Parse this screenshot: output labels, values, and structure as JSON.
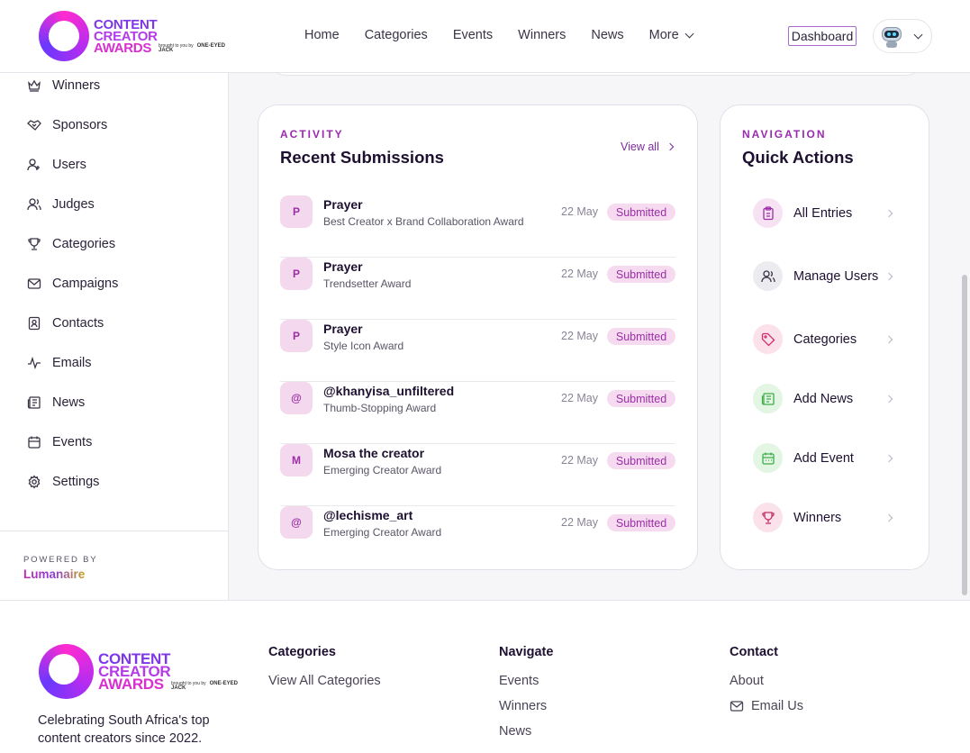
{
  "brand": {
    "name_lines": [
      "CONTENT",
      "CREATOR",
      "AWARDS"
    ],
    "brought_by": "brought to you by",
    "sponsor": "ONE-EYED JACK"
  },
  "nav": {
    "items": [
      "Home",
      "Categories",
      "Events",
      "Winners",
      "News"
    ],
    "more": "More",
    "dashboard": "Dashboard"
  },
  "sidebar": {
    "items": [
      {
        "label": "Winners",
        "icon": "crown-icon"
      },
      {
        "label": "Sponsors",
        "icon": "handshake-icon"
      },
      {
        "label": "Users",
        "icon": "user-icon"
      },
      {
        "label": "Judges",
        "icon": "users-icon"
      },
      {
        "label": "Categories",
        "icon": "trophy-icon"
      },
      {
        "label": "Campaigns",
        "icon": "mail-icon"
      },
      {
        "label": "Contacts",
        "icon": "contact-card-icon"
      },
      {
        "label": "Emails",
        "icon": "activity-icon"
      },
      {
        "label": "News",
        "icon": "newspaper-icon"
      },
      {
        "label": "Events",
        "icon": "calendar-icon"
      },
      {
        "label": "Settings",
        "icon": "gear-icon"
      }
    ],
    "powered_by": "POWERED BY",
    "vendor": "Lumanaire"
  },
  "activity": {
    "eyebrow": "ACTIVITY",
    "title": "Recent Submissions",
    "view_all": "View all",
    "rows": [
      {
        "initial": "P",
        "name": "Prayer",
        "category": "Best Creator x Brand Collaboration Award",
        "date": "22 May",
        "status": "Submitted"
      },
      {
        "initial": "P",
        "name": "Prayer",
        "category": "Trendsetter Award",
        "date": "22 May",
        "status": "Submitted"
      },
      {
        "initial": "P",
        "name": "Prayer",
        "category": "Style Icon Award",
        "date": "22 May",
        "status": "Submitted"
      },
      {
        "initial": "@",
        "name": "@khanyisa_unfiltered",
        "category": "Thumb-Stopping Award",
        "date": "22 May",
        "status": "Submitted"
      },
      {
        "initial": "M",
        "name": "Mosa the creator",
        "category": "Emerging Creator Award",
        "date": "22 May",
        "status": "Submitted"
      },
      {
        "initial": "@",
        "name": "@lechisme_art",
        "category": "Emerging Creator Award",
        "date": "22 May",
        "status": "Submitted"
      }
    ]
  },
  "quick_actions": {
    "eyebrow": "NAVIGATION",
    "title": "Quick Actions",
    "items": [
      {
        "label": "All Entries",
        "icon": "clipboard-icon",
        "color": "#9b2ea6"
      },
      {
        "label": "Manage Users",
        "icon": "users-icon",
        "color": "#3a3346"
      },
      {
        "label": "Categories",
        "icon": "tag-icon",
        "color": "#d0306e"
      },
      {
        "label": "Add News",
        "icon": "newspaper-icon",
        "color": "#3fae4a"
      },
      {
        "label": "Add Event",
        "icon": "calendar-icon",
        "color": "#3fae4a"
      },
      {
        "label": "Winners",
        "icon": "trophy-icon",
        "color": "#c0306a"
      }
    ]
  },
  "footer": {
    "tagline": "Celebrating South Africa's top content creators since 2022.",
    "categories_title": "Categories",
    "categories_links": [
      "View All Categories"
    ],
    "navigate_title": "Navigate",
    "navigate_links": [
      "Events",
      "Winners",
      "News"
    ],
    "contact_title": "Contact",
    "contact_links": [
      "About",
      "Email Us"
    ]
  },
  "colors": {
    "accent": "#9b2ea6",
    "badge_bg": "#f6dbf0",
    "avatar_bg": "#f4d8ee"
  }
}
